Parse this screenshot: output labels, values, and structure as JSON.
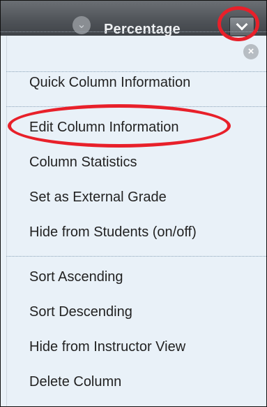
{
  "header": {
    "title": "Percentage"
  },
  "menu": {
    "items": [
      "Quick Column Information",
      "Edit Column Information",
      "Column Statistics",
      "Set as External Grade",
      "Hide from Students (on/off)",
      "Sort Ascending",
      "Sort Descending",
      "Hide from Instructor View",
      "Delete Column"
    ]
  },
  "colors": {
    "callout_red": "#e8202a",
    "menu_background": "#e9f1f8",
    "header_dark": "#4e5257"
  }
}
